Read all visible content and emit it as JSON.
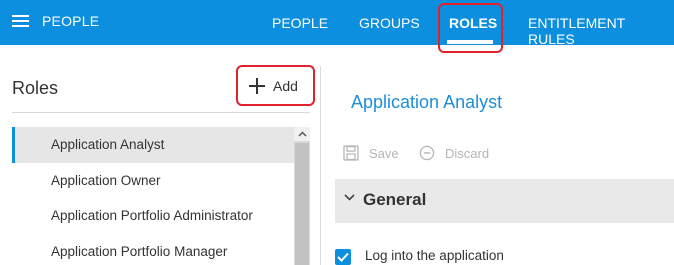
{
  "header": {
    "app_title": "PEOPLE",
    "tabs": [
      {
        "label": "PEOPLE"
      },
      {
        "label": "GROUPS"
      },
      {
        "label": "ROLES",
        "active": true
      },
      {
        "label": "ENTITLEMENT RULES"
      }
    ],
    "bar_color": "#0b8fde"
  },
  "roles_panel": {
    "title": "Roles",
    "add_label": "Add",
    "items": [
      {
        "label": "Application Analyst",
        "selected": true
      },
      {
        "label": "Application Owner"
      },
      {
        "label": "Application Portfolio Administrator"
      },
      {
        "label": "Application Portfolio Manager"
      }
    ]
  },
  "detail": {
    "title": "Application Analyst",
    "save_label": "Save",
    "discard_label": "Discard",
    "section_title": "General",
    "permission_label": "Log into the application",
    "permission_checked": true
  },
  "icons": {
    "menu": "hamburger-icon",
    "add": "plus-icon",
    "save": "floppy-disk-icon",
    "discard": "circle-minus-icon",
    "section": "chevron-down-icon",
    "scroll": "chevron-up-icon",
    "checkbox": "checkmark-icon"
  },
  "highlight_color": "#e0222d",
  "accent_color": "#1f8ed8"
}
